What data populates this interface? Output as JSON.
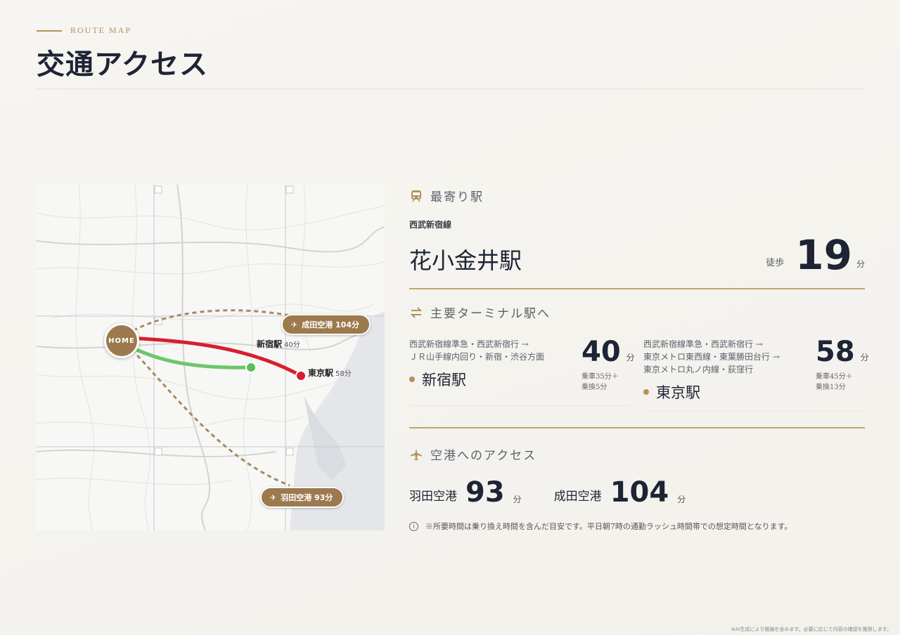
{
  "header": {
    "eyebrow": "ROUTE MAP",
    "title": "交通アクセス"
  },
  "map": {
    "home_label": "HOME",
    "stations": [
      {
        "name": "新宿駅",
        "minutes": "40分",
        "color": "#5cbf5c"
      },
      {
        "name": "東京駅",
        "minutes": "58分",
        "color": "#d61f2c"
      }
    ],
    "airport_pins": [
      {
        "label": "成田空港 104分"
      },
      {
        "label": "羽田空港 93分"
      }
    ]
  },
  "nearest": {
    "heading": "最寄り駅",
    "icon": "train-icon",
    "line": "西武新宿線",
    "station": "花小金井駅",
    "walk_label": "徒歩",
    "walk_minutes": "19",
    "unit": "分"
  },
  "terminals": {
    "heading": "主要ターミナル駅へ",
    "icon": "swap-arrows-icon",
    "items": [
      {
        "route_lines": [
          "西武新宿線準急・西武新宿行 →",
          "ＪＲ山手線内回り・新宿・渋谷方面"
        ],
        "station": "新宿駅",
        "minutes": "40",
        "unit": "分",
        "note_lines": [
          "乗車35分＋",
          "乗換5分"
        ]
      },
      {
        "route_lines": [
          "西武新宿線準急・西武新宿行 →",
          "東京メトロ東西線・東葉勝田台行 →",
          "東京メトロ丸ノ内線・荻窪行"
        ],
        "station": "東京駅",
        "minutes": "58",
        "unit": "分",
        "note_lines": [
          "乗車45分＋",
          "乗換13分"
        ]
      }
    ]
  },
  "airports": {
    "heading": "空港へのアクセス",
    "icon": "airplane-icon",
    "items": [
      {
        "name": "羽田空港",
        "minutes": "93",
        "unit": "分"
      },
      {
        "name": "成田空港",
        "minutes": "104",
        "unit": "分"
      }
    ]
  },
  "footnote": "※所要時間は乗り換え時間を含んだ目安です。平日朝7時の通勤ラッシュ時間帯での想定時間となります。",
  "disclaimer": "※AI生成により推論を含みます。必要に応じて内容の確認を推奨します。",
  "colors": {
    "gold": "#b3925a",
    "pin": "#9c7a4e",
    "navy": "#1d2434"
  }
}
